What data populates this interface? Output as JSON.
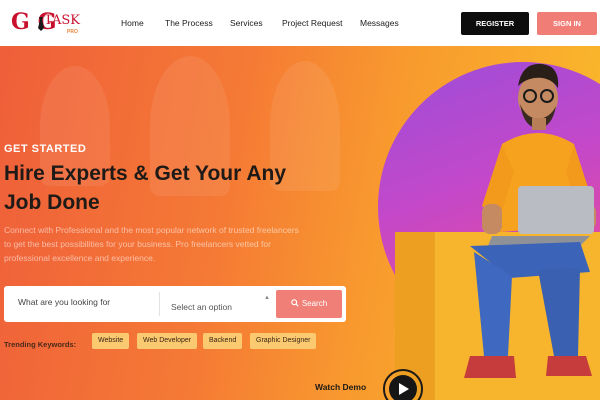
{
  "brand": {
    "logo_g": "G",
    "logo_g2": "G",
    "logo_task": "TASK",
    "logo_pro": "PRO"
  },
  "nav": {
    "links": [
      "Home",
      "The Process",
      "Services",
      "Project Request",
      "Messages"
    ],
    "register": "REGISTER",
    "signin": "SIGN IN"
  },
  "hero": {
    "eyebrow": "GET STARTED",
    "headline": "Hire Experts & Get Your Any Job Done",
    "description": "Connect with Professional and the most popular network of trusted freelancers to get the best possibilities for your business. Pro freelancers vetted for professional excellence and experience."
  },
  "search": {
    "placeholder": "What are you looking for",
    "select_value": "Select an option",
    "button": "Search"
  },
  "trending": {
    "label": "Trending Keywords:",
    "keywords": [
      "Website",
      "Web Developer",
      "Backend",
      "Graphic Designer"
    ]
  },
  "watch_demo": "Watch Demo",
  "colors": {
    "accent": "#f07f77",
    "dark": "#0d0d0d",
    "brand_red": "#c8102e",
    "keyword_bg": "#fbc96f"
  }
}
